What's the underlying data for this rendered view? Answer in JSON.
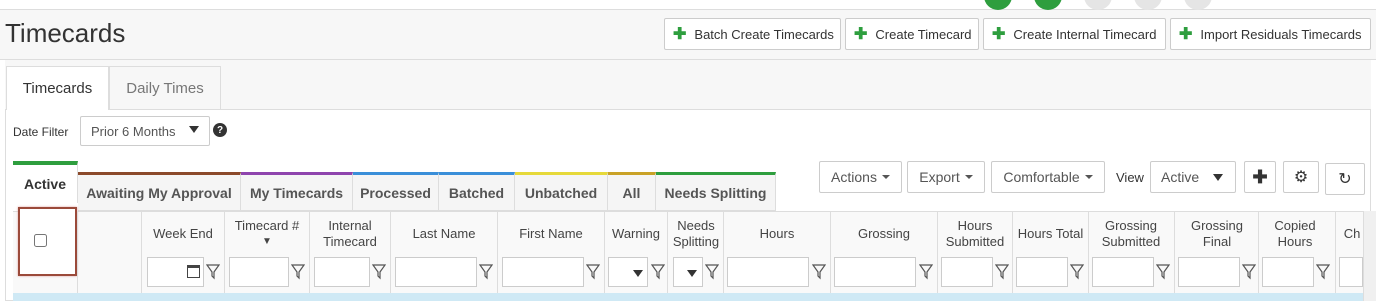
{
  "header": {
    "title": "Timecards",
    "buttons": [
      {
        "label": "Batch Create Timecards"
      },
      {
        "label": "Create Timecard"
      },
      {
        "label": "Create Internal Timecard"
      },
      {
        "label": "Import Residuals Timecards"
      }
    ]
  },
  "main_tabs": [
    {
      "label": "Timecards",
      "active": true
    },
    {
      "label": "Daily Times",
      "active": false
    }
  ],
  "filter": {
    "label": "Date Filter",
    "value": "Prior 6 Months"
  },
  "status_tabs": [
    {
      "label": "Active",
      "color": "#2e9e3e"
    },
    {
      "label": "Awaiting My Approval",
      "color": "#8b4a2b"
    },
    {
      "label": "My Timecards",
      "color": "#8e44ad"
    },
    {
      "label": "Processed",
      "color": "#3a8fd9"
    },
    {
      "label": "Batched",
      "color": "#3a8fd9"
    },
    {
      "label": "Unbatched",
      "color": "#e6d93a"
    },
    {
      "label": "All",
      "color": "#c9a227"
    },
    {
      "label": "Needs Splitting",
      "color": "#2e9e3e"
    }
  ],
  "toolbar": {
    "actions": "Actions",
    "export": "Export",
    "density": "Comfortable",
    "view_label": "View",
    "view_value": "Active"
  },
  "columns": [
    {
      "label": "Week End"
    },
    {
      "label": "Timecard #"
    },
    {
      "label": "Internal Timecard"
    },
    {
      "label": "Last Name"
    },
    {
      "label": "First Name"
    },
    {
      "label": "Warning"
    },
    {
      "label": "Needs Splitting"
    },
    {
      "label": "Hours"
    },
    {
      "label": "Grossing"
    },
    {
      "label": "Hours Submitted"
    },
    {
      "label": "Hours Total"
    },
    {
      "label": "Grossing Submitted"
    },
    {
      "label": "Grossing Final"
    },
    {
      "label": "Copied Hours"
    },
    {
      "label": "Ch"
    }
  ]
}
